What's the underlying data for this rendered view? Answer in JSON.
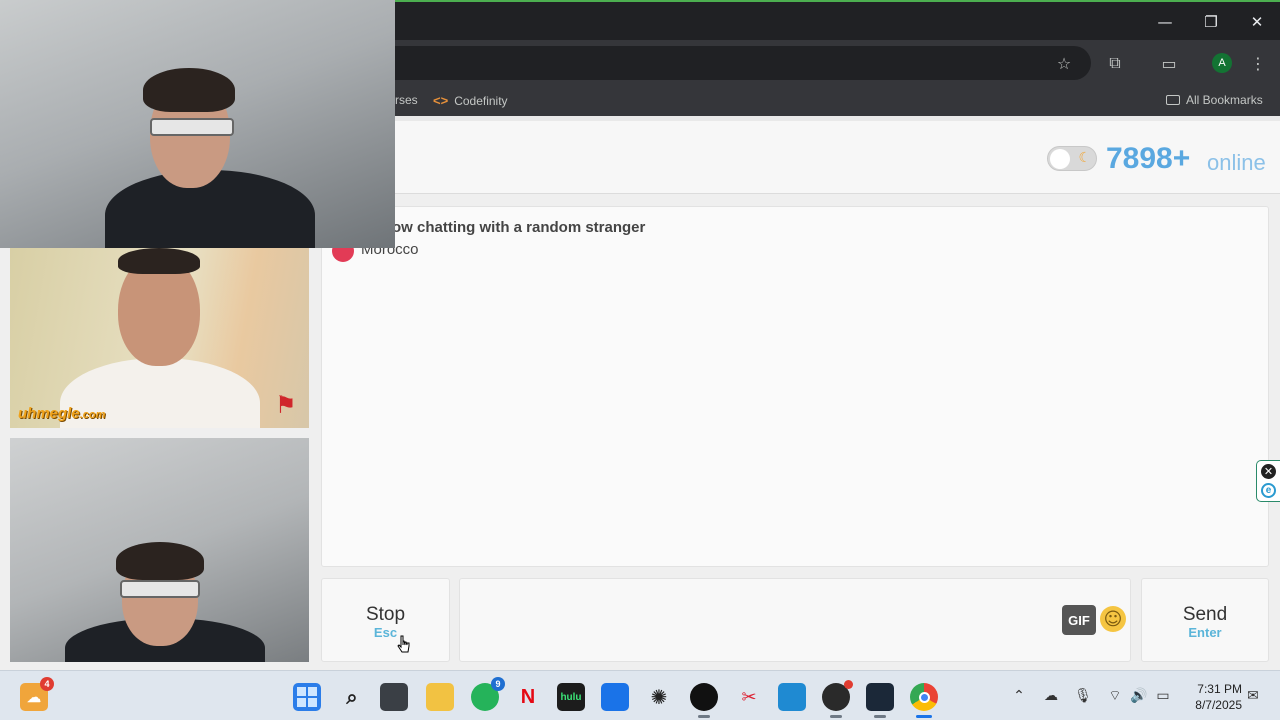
{
  "window": {
    "minimize": "—",
    "restore": "❐",
    "close": "✕"
  },
  "toolbar": {
    "star_icon": "star-icon",
    "extensions_icon": "puzzle-icon",
    "cast_icon": "screen-search-icon",
    "profile_initial": "A",
    "menu_icon": "kebab-menu-icon"
  },
  "bookmarks": {
    "items": [
      {
        "label": "rses",
        "icon": "none"
      },
      {
        "label": "Codefinity",
        "icon": "code-brackets-icon"
      }
    ],
    "all_bookmarks": "All Bookmarks"
  },
  "site": {
    "theme_toggle_icon": "moon-icon",
    "online_count": "7898+",
    "online_label": "online",
    "chat_status": "ow chatting with a random stranger",
    "stranger_country": "Morocco",
    "stop_label": "Stop",
    "stop_shortcut": "Esc",
    "gif_label": "GIF",
    "send_label": "Send",
    "send_shortcut": "Enter",
    "stranger_watermark": "uhmegle",
    "stranger_watermark_suffix": ".com"
  },
  "taskbar": {
    "weather_badge": "4",
    "whatsapp_badge": "9",
    "netflix_label": "N",
    "hulu_label": "hulu",
    "time": "7:31 PM",
    "date": "8/7/2025"
  },
  "colors": {
    "accent_online": "#5aa8e0",
    "stop_shortcut": "#5bb5d9",
    "country_dot": "#e23b56",
    "window_border": "#4caf50"
  }
}
